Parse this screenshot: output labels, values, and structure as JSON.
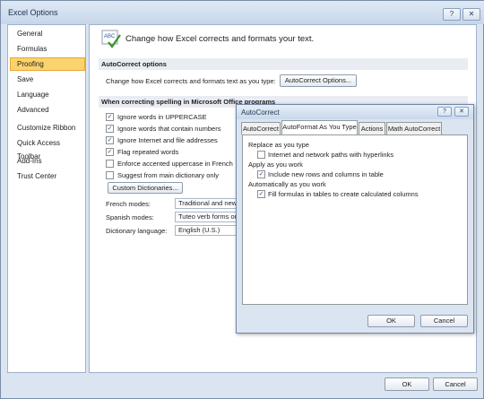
{
  "window": {
    "title": "Excel Options",
    "help_btn": "?",
    "close_btn": "✕"
  },
  "nav": {
    "items": [
      {
        "label": "General"
      },
      {
        "label": "Formulas"
      },
      {
        "label": "Proofing"
      },
      {
        "label": "Save"
      },
      {
        "label": "Language"
      },
      {
        "label": "Advanced"
      },
      {
        "label": "Customize Ribbon"
      },
      {
        "label": "Quick Access Toolbar"
      },
      {
        "label": "Add-Ins"
      },
      {
        "label": "Trust Center"
      }
    ],
    "selected": "Proofing"
  },
  "content": {
    "header": "Change how Excel corrects and formats your text.",
    "autocorrect_section": "AutoCorrect options",
    "autocorrect_desc": "Change how Excel corrects and formats text as you type:",
    "autocorrect_button": "AutoCorrect Options...",
    "spelling_section": "When correcting spelling in Microsoft Office programs",
    "checkboxes": [
      {
        "label": "Ignore words in UPPERCASE",
        "checked": true
      },
      {
        "label": "Ignore words that contain numbers",
        "checked": true
      },
      {
        "label": "Ignore Internet and file addresses",
        "checked": true
      },
      {
        "label": "Flag repeated words",
        "checked": true
      },
      {
        "label": "Enforce accented uppercase in French",
        "checked": false
      },
      {
        "label": "Suggest from main dictionary only",
        "checked": false
      }
    ],
    "custom_dict_button": "Custom Dictionaries...",
    "french_label": "French modes:",
    "french_value": "Traditional and new",
    "spanish_label": "Spanish modes:",
    "spanish_value": "Tuteo verb forms only",
    "dict_label": "Dictionary language:",
    "dict_value": "English (U.S.)"
  },
  "dialog": {
    "title": "AutoCorrect",
    "help_btn": "?",
    "close_btn": "✕",
    "tabs": [
      {
        "label": "AutoCorrect",
        "active": false
      },
      {
        "label": "AutoFormat As You Type",
        "active": true
      },
      {
        "label": "Actions",
        "active": false
      },
      {
        "label": "Math AutoCorrect",
        "active": false
      }
    ],
    "groups": [
      {
        "heading": "Replace as you type",
        "option": "Internet and network paths with hyperlinks",
        "checked": false
      },
      {
        "heading": "Apply as you work",
        "option": "Include new rows and columns in table",
        "checked": true
      },
      {
        "heading": "Automatically as you work",
        "option": "Fill formulas in tables to create calculated columns",
        "checked": true
      }
    ],
    "ok_label": "OK",
    "cancel_label": "Cancel"
  },
  "footer": {
    "ok_label": "OK",
    "cancel_label": "Cancel"
  },
  "colors": {
    "selected_nav": "#fbd36d",
    "window_bg": "#dbe5f1",
    "section_bg": "#e9edf3"
  }
}
